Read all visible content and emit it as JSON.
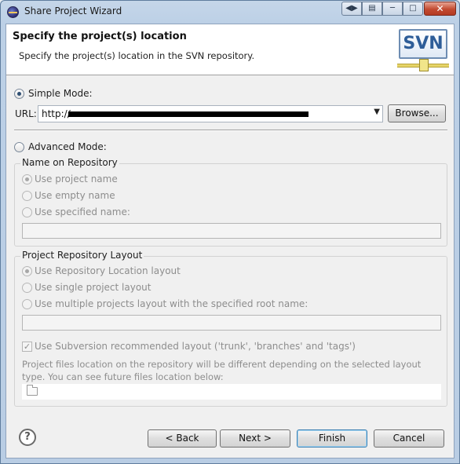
{
  "window": {
    "title": "Share Project Wizard"
  },
  "header": {
    "title": "Specify the project(s) location",
    "description": "Specify the project(s) location in the SVN repository.",
    "logo_text": "SVN"
  },
  "simple_mode": {
    "label": "Simple Mode:",
    "selected": true,
    "url_label": "URL:",
    "url_value": "http://",
    "browse_label": "Browse..."
  },
  "advanced_mode": {
    "label": "Advanced Mode:",
    "selected": false
  },
  "name_group": {
    "title": "Name on Repository",
    "options": [
      "Use project name",
      "Use empty name",
      "Use specified name:"
    ],
    "selected_index": 0
  },
  "layout_group": {
    "title": "Project Repository Layout",
    "options": [
      "Use Repository Location layout",
      "Use single project layout",
      "Use multiple projects layout with the specified root name:"
    ],
    "selected_index": 0,
    "recommended_label": "Use Subversion recommended layout ('trunk', 'branches' and 'tags')",
    "recommended_checked": true,
    "description": "Project files location on the repository will be different depending on the selected layout type. You can see future files location below:"
  },
  "footer": {
    "back_label": "< Back",
    "next_label": "Next >",
    "finish_label": "Finish",
    "cancel_label": "Cancel"
  },
  "icons": {
    "title": "eclipse-icon",
    "help": "help-icon",
    "folder": "folder-icon",
    "dropdown": "chevron-down-icon"
  }
}
